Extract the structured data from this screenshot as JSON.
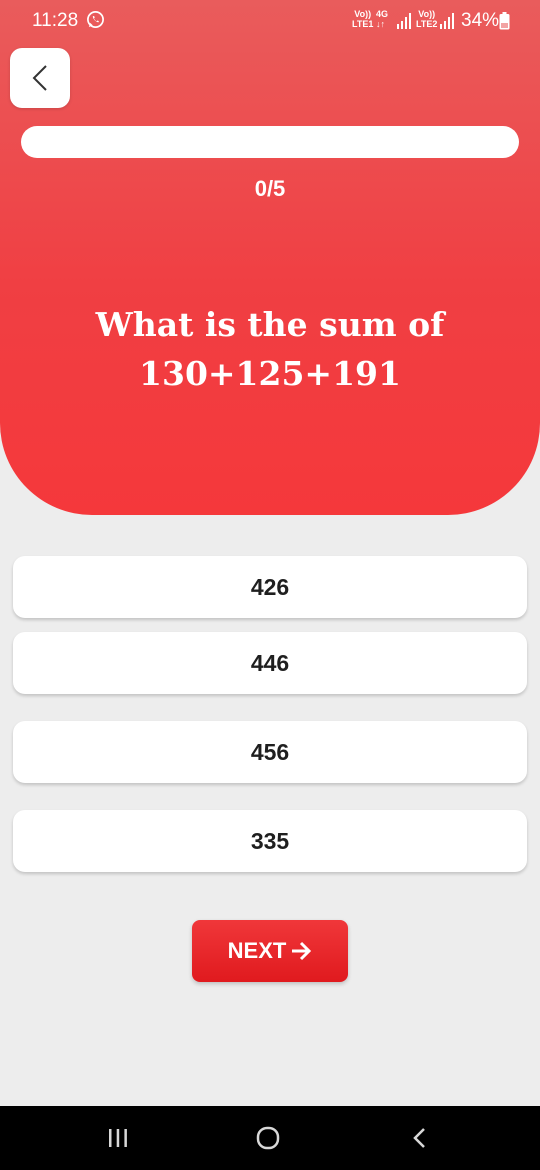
{
  "status_bar": {
    "time": "11:28",
    "sim1_top": "Vo))",
    "sim1_bottom": "LTE1",
    "network": "4G",
    "sim2_top": "Vo))",
    "sim2_bottom": "LTE2",
    "battery": "34%"
  },
  "quiz": {
    "progress_fraction": 0,
    "progress_label": "0/5",
    "question_line1": "What is the sum of",
    "question_line2": "130+125+191",
    "options": [
      "426",
      "446",
      "456",
      "335"
    ],
    "next_label": "NEXT"
  },
  "colors": {
    "header_top": "#e95c5c",
    "header_bottom": "#f5383b",
    "button_red": "#e01a1e",
    "page_background": "#ededed"
  },
  "icons": {
    "back": "chevron-left-icon",
    "next": "arrow-right-icon",
    "status": [
      "whatsapp-icon",
      "signal-icon",
      "battery-icon"
    ],
    "navbar": [
      "recents-icon",
      "home-icon",
      "back-icon"
    ]
  }
}
